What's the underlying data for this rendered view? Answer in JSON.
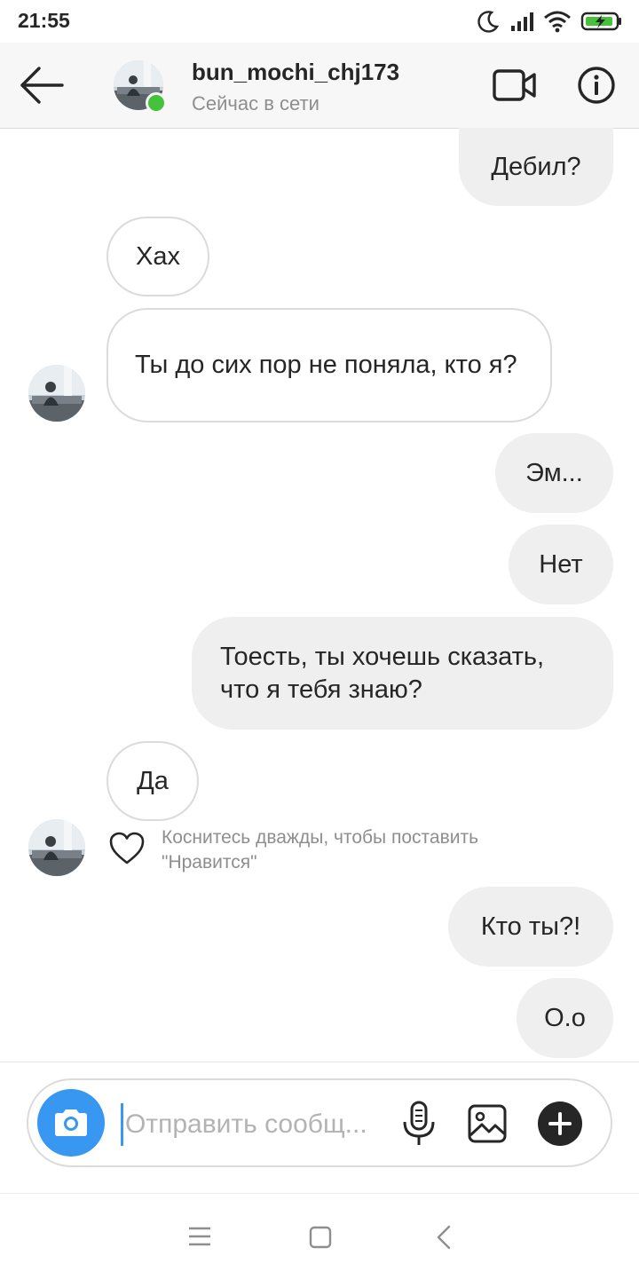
{
  "status_bar": {
    "time": "21:55"
  },
  "header": {
    "username": "bun_mochi_chj173",
    "status": "Сейчас в сети"
  },
  "messages": [
    {
      "direction": "out",
      "text": "Дебил?"
    },
    {
      "direction": "in",
      "text": "Хах"
    },
    {
      "direction": "in",
      "text": "Ты до сих пор не поняла, кто я?"
    },
    {
      "direction": "out",
      "text": "Эм..."
    },
    {
      "direction": "out",
      "text": "Нет"
    },
    {
      "direction": "out",
      "text": "Тоесть, ты хочешь сказать, что я тебя знаю?"
    },
    {
      "direction": "in",
      "text": "Да"
    },
    {
      "direction": "out",
      "text": "Кто ты?!"
    },
    {
      "direction": "out",
      "text": "О.о"
    }
  ],
  "like_hint": "Коснитесь дважды, чтобы поставить \"Нравится\"",
  "composer": {
    "placeholder": "Отправить сообщ..."
  },
  "icons": {
    "back": "arrow-left-icon",
    "video": "video-camera-icon",
    "info": "info-icon",
    "camera": "camera-icon",
    "mic": "microphone-icon",
    "gallery": "image-icon",
    "plus": "plus-icon",
    "like": "heart-icon"
  },
  "colors": {
    "accent": "#3897f0",
    "online": "#44c23a",
    "battery": "#44c23a"
  }
}
